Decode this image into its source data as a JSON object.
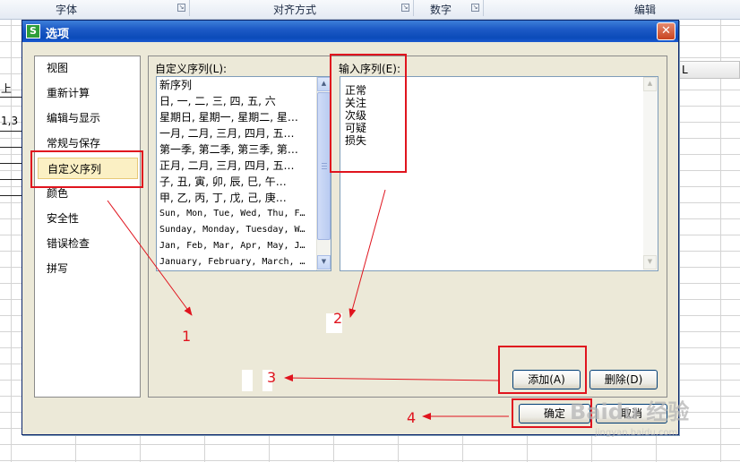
{
  "ribbon": {
    "groups": [
      {
        "label": "字体"
      },
      {
        "label": "对齐方式"
      },
      {
        "label": "数字"
      },
      {
        "label": "编辑"
      }
    ]
  },
  "sheet": {
    "column_header": "L",
    "left_cell_text_1": "上",
    "left_cell_text_2": "1,3"
  },
  "dialog": {
    "title": "选项",
    "app_icon_letter": "S",
    "close_label": "✕",
    "nav": {
      "items": [
        {
          "label": "视图"
        },
        {
          "label": "重新计算"
        },
        {
          "label": "编辑与显示"
        },
        {
          "label": "常规与保存"
        },
        {
          "label": "自定义序列"
        },
        {
          "label": "颜色"
        },
        {
          "label": "安全性"
        },
        {
          "label": "错误检查"
        },
        {
          "label": "拼写"
        }
      ],
      "selected": "自定义序列"
    },
    "custom_list": {
      "label": "自定义序列(L):",
      "items": [
        "新序列",
        "日, 一, 二, 三, 四, 五, 六",
        "星期日, 星期一, 星期二, 星…",
        "一月, 二月, 三月, 四月, 五…",
        "第一季, 第二季, 第三季, 第…",
        "正月, 二月, 三月, 四月, 五…",
        "子, 丑, 寅, 卯, 辰, 巳, 午…",
        "甲, 乙, 丙, 丁, 戊, 己, 庚…",
        "Sun, Mon, Tue, Wed, Thu, F…",
        "Sunday, Monday, Tuesday, W…",
        "Jan, Feb, Mar, Apr, May, J…",
        "January, February, March, …"
      ]
    },
    "input_sequence": {
      "label": "输入序列(E):",
      "lines": [
        "正常",
        "关注",
        "次级",
        "可疑",
        "损失"
      ]
    },
    "buttons": {
      "add": "添加(A)",
      "delete": "删除(D)",
      "ok": "确定",
      "cancel": "取消"
    }
  },
  "annotations": {
    "step_1": "1",
    "step_2": "2",
    "step_3": "3",
    "step_4": "4",
    "accent_color": "#e0141e"
  },
  "watermark": {
    "main": "Baidu 经验",
    "sub": "jingyan.baidu.com"
  },
  "icons": {
    "dialog_launcher": "dialog-launcher-icon",
    "scroll_up": "scroll-up-arrow-icon",
    "scroll_down": "scroll-down-arrow-icon",
    "close": "close-icon",
    "app": "wps-spreadsheet-icon"
  }
}
